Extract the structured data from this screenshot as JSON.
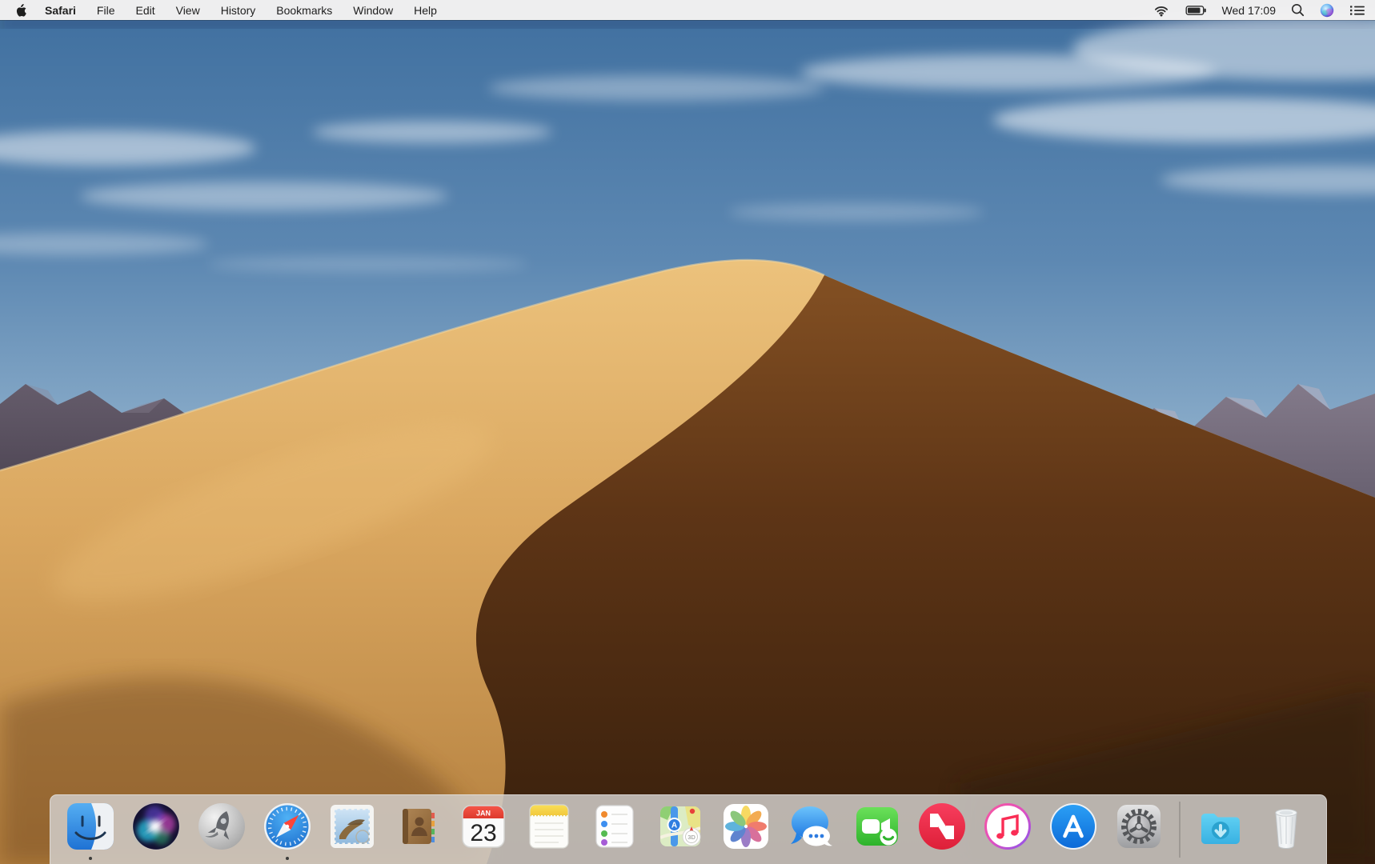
{
  "os": "macOS Mojave desktop",
  "menubar": {
    "apple_menu_icon": "apple-logo-icon",
    "active_app": "Safari",
    "items": [
      "Safari",
      "File",
      "Edit",
      "View",
      "History",
      "Bookmarks",
      "Window",
      "Help"
    ],
    "status": {
      "clock": "Wed 17:09",
      "icons": [
        "wifi-icon",
        "battery-icon",
        "spotlight-search-icon",
        "siri-icon",
        "notification-center-icon"
      ]
    }
  },
  "dock": {
    "items": [
      {
        "name": "Finder",
        "running": true
      },
      {
        "name": "Siri",
        "running": false
      },
      {
        "name": "Launchpad",
        "running": false
      },
      {
        "name": "Safari",
        "running": true
      },
      {
        "name": "Mail",
        "running": false
      },
      {
        "name": "Contacts",
        "running": false
      },
      {
        "name": "Calendar",
        "running": false
      },
      {
        "name": "Notes",
        "running": false
      },
      {
        "name": "Reminders",
        "running": false
      },
      {
        "name": "Maps",
        "running": false
      },
      {
        "name": "Photos",
        "running": false
      },
      {
        "name": "Messages",
        "running": false
      },
      {
        "name": "FaceTime",
        "running": false
      },
      {
        "name": "News",
        "running": false
      },
      {
        "name": "iTunes",
        "running": false
      },
      {
        "name": "App Store",
        "running": false
      },
      {
        "name": "System Preferences",
        "running": false
      },
      {
        "name": "Downloads",
        "running": false
      },
      {
        "name": "Trash",
        "running": false
      }
    ],
    "calendar": {
      "month": "JAN",
      "day": "23"
    },
    "maps_badge": "3D",
    "maps_road_label": "A"
  },
  "colors": {
    "menu_bar_bg": "#f6f4f2",
    "dock_bg": "#d1cec9",
    "sky_top": "#3f6f9f",
    "sky_horizon": "#b9c9d6",
    "sand_light": "#ddab63",
    "sand_shadow": "#47280f",
    "mountain": "#5a5160"
  },
  "wallpaper": "Mojave desert sand dune with blue sky, clouds and mountains"
}
